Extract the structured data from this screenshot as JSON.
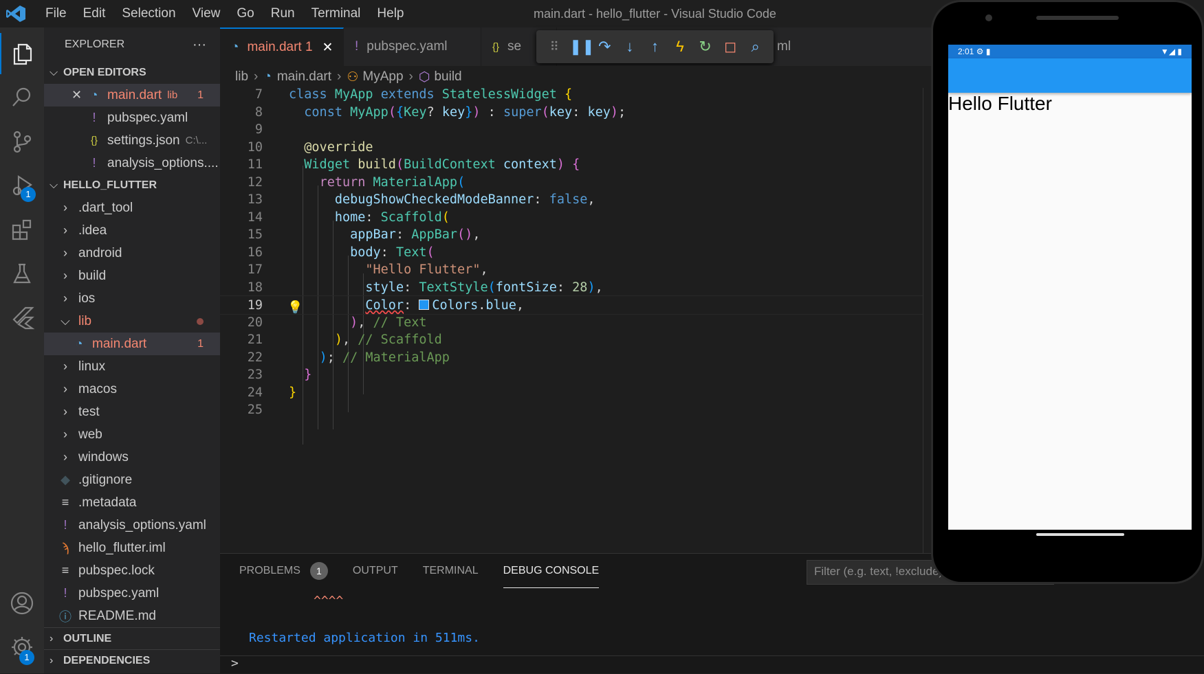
{
  "window": {
    "title": "main.dart - hello_flutter - Visual Studio Code"
  },
  "menu": [
    "File",
    "Edit",
    "Selection",
    "View",
    "Go",
    "Run",
    "Terminal",
    "Help"
  ],
  "activity": {
    "debug_badge": "1",
    "settings_badge": "1"
  },
  "sidebar": {
    "title": "EXPLORER",
    "more": "···",
    "open_editors_title": "OPEN EDITORS",
    "open_editors": [
      {
        "name": "main.dart",
        "hint": "lib",
        "count": "1"
      },
      {
        "name": "pubspec.yaml"
      },
      {
        "name": "settings.json",
        "hint": "C:\\..."
      },
      {
        "name": "analysis_options...."
      }
    ],
    "project_title": "HELLO_FLUTTER",
    "tree": [
      ".dart_tool",
      ".idea",
      "android",
      "build",
      "ios",
      "lib",
      "main.dart",
      "linux",
      "macos",
      "test",
      "web",
      "windows",
      ".gitignore",
      ".metadata",
      "analysis_options.yaml",
      "hello_flutter.iml",
      "pubspec.lock",
      "pubspec.yaml",
      "README.md"
    ],
    "main_dart_count": "1",
    "outline_title": "OUTLINE",
    "dependencies_title": "DEPENDENCIES"
  },
  "tabs": [
    {
      "label": "main.dart",
      "count": "1"
    },
    {
      "label": "pubspec.yaml"
    },
    {
      "label": "se"
    },
    {
      "label": "ml"
    }
  ],
  "breadcrumb": [
    "lib",
    "main.dart",
    "MyApp",
    "build"
  ],
  "editor": {
    "current_line": "19"
  },
  "panel": {
    "tabs": [
      "PROBLEMS",
      "OUTPUT",
      "TERMINAL",
      "DEBUG CONSOLE"
    ],
    "problems_count": "1",
    "filter_placeholder": "Filter (e.g. text, !exclude)",
    "caret_line": "^^^^",
    "restart_message": "Restarted application in 511ms.",
    "prompt": ">"
  },
  "phone": {
    "time": "2:01",
    "body_text": "Hello Flutter"
  }
}
